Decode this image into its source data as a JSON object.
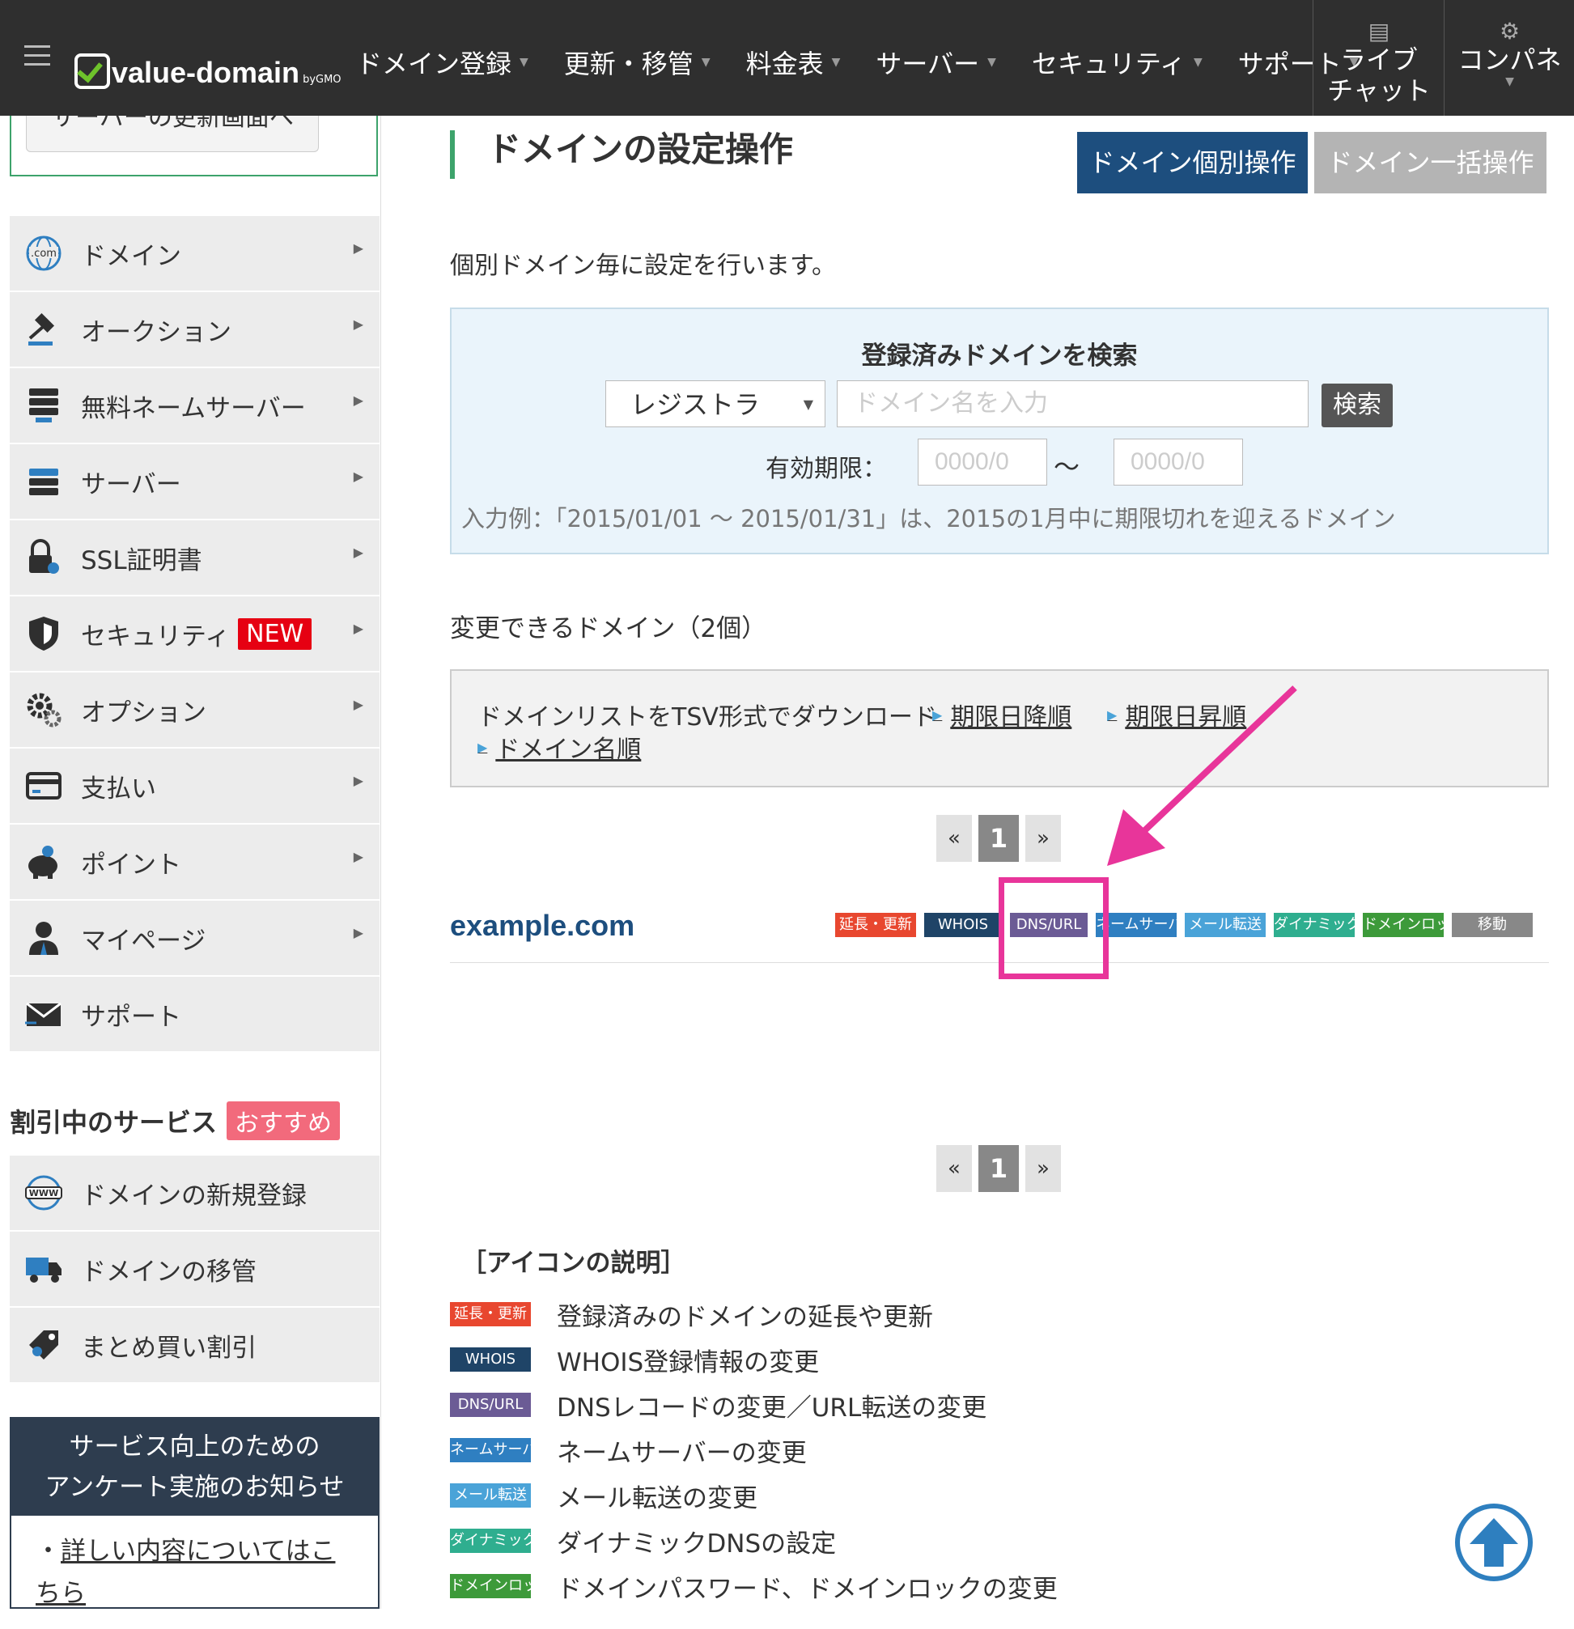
{
  "header": {
    "logo_text": "value-domain",
    "logo_by": "byGMO",
    "nav": [
      {
        "label": "ドメイン登録"
      },
      {
        "label": "更新・移管"
      },
      {
        "label": "料金表"
      },
      {
        "label": "サーバー"
      },
      {
        "label": "セキュリティ"
      },
      {
        "label": "サポート"
      }
    ],
    "live_chat": {
      "line1": "ライブ",
      "line2": "チャット"
    },
    "control_panel": "コンパネ"
  },
  "sidebar": {
    "top_button_label": "サーバーの更新画面へ",
    "menu": [
      {
        "label": "ドメイン",
        "icon": "globe-com-icon"
      },
      {
        "label": "オークション",
        "icon": "gavel-icon"
      },
      {
        "label": "無料ネームサーバー",
        "icon": "server-stack-icon"
      },
      {
        "label": "サーバー",
        "icon": "server-icon"
      },
      {
        "label": "SSL証明書",
        "icon": "lock-icon"
      },
      {
        "label": "セキュリティ",
        "icon": "shield-icon",
        "badge": "NEW"
      },
      {
        "label": "オプション",
        "icon": "gears-icon"
      },
      {
        "label": "支払い",
        "icon": "card-icon"
      },
      {
        "label": "ポイント",
        "icon": "piggy-bank-icon"
      },
      {
        "label": "マイページ",
        "icon": "user-icon"
      },
      {
        "label": "サポート",
        "icon": "mail-icon"
      }
    ],
    "discount": {
      "title": "割引中のサービス",
      "badge": "おすすめ",
      "items": [
        {
          "label": "ドメインの新規登録",
          "icon": "www-globe-icon"
        },
        {
          "label": "ドメインの移管",
          "icon": "truck-icon"
        },
        {
          "label": "まとめ買い割引",
          "icon": "tag-icon"
        }
      ]
    },
    "survey": {
      "heading_line1": "サービス向上のための",
      "heading_line2": "アンケート実施のお知らせ",
      "link_text": "詳しい内容についてはこちら",
      "bullet": "・"
    }
  },
  "main": {
    "title": "ドメインの設定操作",
    "btn_individual": "ドメイン個別操作",
    "btn_bulk": "ドメイン一括操作",
    "intro": "個別ドメイン毎に設定を行います。",
    "search": {
      "title": "登録済みドメインを検索",
      "registrar_value": "レジストラ",
      "domain_placeholder": "ドメイン名を入力",
      "button": "検索",
      "expiry_label": "有効期限：",
      "date_from_placeholder": "0000/0",
      "date_to_placeholder": "0000/0",
      "tilde": "〜",
      "example": "入力例：「2015/01/01 〜 2015/01/31」は、2015の1月中に期限切れを迎えるドメイン"
    },
    "count_title": "変更できるドメイン（2個）",
    "tsv": {
      "label": "ドメインリストをTSV形式でダウンロード",
      "links": [
        "期限日降順",
        "期限日昇順",
        "ドメイン名順"
      ]
    },
    "pager": {
      "prev": "«",
      "current": "1",
      "next": "»"
    },
    "domain": {
      "name": "example.com",
      "tags": [
        {
          "label": "延長・更新",
          "color": "#e8472f"
        },
        {
          "label": "WHOIS",
          "color": "#1f4467"
        },
        {
          "label": "DNS/URL",
          "color": "#6b5b95"
        },
        {
          "label": "ネームサーバー",
          "color": "#2f7fc1"
        },
        {
          "label": "メール転送",
          "color": "#4aa3d8"
        },
        {
          "label": "ダイナミック",
          "color": "#2fae8f"
        },
        {
          "label": "ドメインロック",
          "color": "#3d9a3a"
        },
        {
          "label": "移動",
          "color": "#888888"
        }
      ]
    },
    "legend": {
      "title": "［アイコンの説明］",
      "items": [
        {
          "tag": "延長・更新",
          "color": "#e8472f",
          "desc": "登録済みのドメインの延長や更新"
        },
        {
          "tag": "WHOIS",
          "color": "#1f4467",
          "desc": "WHOIS登録情報の変更"
        },
        {
          "tag": "DNS/URL",
          "color": "#6b5b95",
          "desc": "DNSレコードの変更／URL転送の変更"
        },
        {
          "tag": "ネームサーバー",
          "color": "#2f7fc1",
          "desc": "ネームサーバーの変更"
        },
        {
          "tag": "メール転送",
          "color": "#4aa3d8",
          "desc": "メール転送の変更"
        },
        {
          "tag": "ダイナミック",
          "color": "#2fae8f",
          "desc": "ダイナミックDNSの設定"
        },
        {
          "tag": "ドメインロック",
          "color": "#3d9a3a",
          "desc": "ドメインパスワード、ドメインロックの変更"
        }
      ]
    }
  },
  "colors": {
    "topbar": "#2f2f2f",
    "primary": "#1d4e7e",
    "accent_green": "#3da36b",
    "highlight": "#e8359a"
  }
}
